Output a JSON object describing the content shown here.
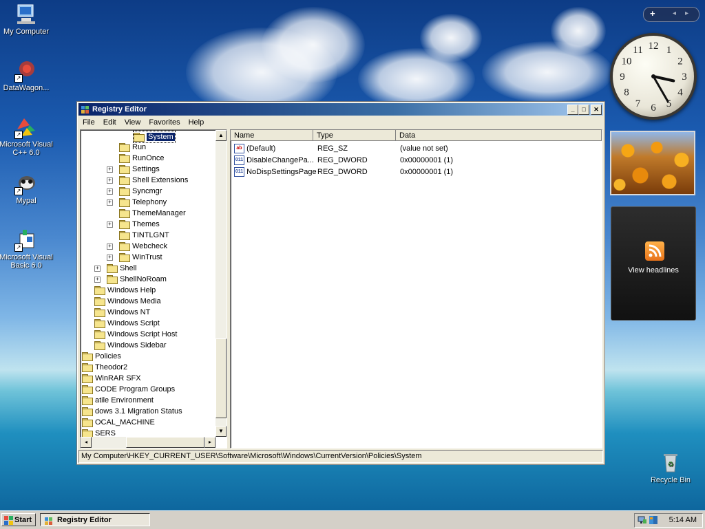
{
  "desktop": {
    "icons": [
      {
        "label": "My Computer"
      },
      {
        "label": "DataWagon..."
      },
      {
        "label": "Microsoft Visual C++ 6.0"
      },
      {
        "label": "Mypal"
      },
      {
        "label": "Microsoft Visual Basic 6.0"
      },
      {
        "label": "Recycle Bin"
      }
    ]
  },
  "window": {
    "title": "Registry Editor",
    "controls": {
      "minimize": "_",
      "maximize": "□",
      "close": "✕"
    },
    "menu": [
      "File",
      "Edit",
      "View",
      "Favorites",
      "Help"
    ],
    "tree": [
      {
        "label": "System",
        "expand": "",
        "selected": true
      },
      {
        "label": "Run",
        "expand": ""
      },
      {
        "label": "RunOnce",
        "expand": ""
      },
      {
        "label": "Settings",
        "expand": "+"
      },
      {
        "label": "Shell Extensions",
        "expand": "+"
      },
      {
        "label": "Syncmgr",
        "expand": "+"
      },
      {
        "label": "Telephony",
        "expand": "+"
      },
      {
        "label": "ThemeManager",
        "expand": ""
      },
      {
        "label": "Themes",
        "expand": "+"
      },
      {
        "label": "TINTLGNT",
        "expand": ""
      },
      {
        "label": "Webcheck",
        "expand": "+"
      },
      {
        "label": "WinTrust",
        "expand": "+"
      },
      {
        "label": "Shell",
        "expand": "+"
      },
      {
        "label": "ShellNoRoam",
        "expand": "+"
      },
      {
        "label": "Windows Help",
        "expand": ""
      },
      {
        "label": "Windows Media",
        "expand": ""
      },
      {
        "label": "Windows NT",
        "expand": ""
      },
      {
        "label": "Windows Script",
        "expand": ""
      },
      {
        "label": "Windows Script Host",
        "expand": ""
      },
      {
        "label": "Windows Sidebar",
        "expand": ""
      },
      {
        "label": "Policies",
        "expand": ""
      },
      {
        "label": "Theodor2",
        "expand": ""
      },
      {
        "label": "WinRAR SFX",
        "expand": ""
      },
      {
        "label": "CODE Program Groups",
        "expand": ""
      },
      {
        "label": "atile Environment",
        "expand": ""
      },
      {
        "label": "dows 3.1 Migration Status",
        "expand": ""
      },
      {
        "label": "OCAL_MACHINE",
        "expand": ""
      },
      {
        "label": "SERS",
        "expand": ""
      }
    ],
    "columns": [
      "Name",
      "Type",
      "Data"
    ],
    "values": [
      {
        "icon": "ab",
        "name": "(Default)",
        "type": "REG_SZ",
        "data": "(value not set)"
      },
      {
        "icon": "011",
        "name": "DisableChangePa...",
        "type": "REG_DWORD",
        "data": "0x00000001 (1)"
      },
      {
        "icon": "011",
        "name": "NoDispSettingsPage",
        "type": "REG_DWORD",
        "data": "0x00000001 (1)"
      }
    ],
    "status": "My Computer\\HKEY_CURRENT_USER\\Software\\Microsoft\\Windows\\CurrentVersion\\Policies\\System"
  },
  "sidebar": {
    "toolbar": {
      "add": "+",
      "prev": "◂",
      "next": "▸"
    },
    "clock": {
      "numbers": [
        "12",
        "1",
        "2",
        "3",
        "4",
        "5",
        "6",
        "7",
        "8",
        "9",
        "10",
        "11"
      ],
      "hour": 3,
      "minute": 25
    },
    "feed": {
      "label": "View headlines"
    }
  },
  "taskbar": {
    "start": "Start",
    "task": "Registry Editor",
    "time": "5:14 AM"
  },
  "colors": {
    "titlebar": "#0a246a",
    "selection": "#0a246a",
    "taskbar": "#d4d0c8",
    "rss": "#f08a24"
  }
}
